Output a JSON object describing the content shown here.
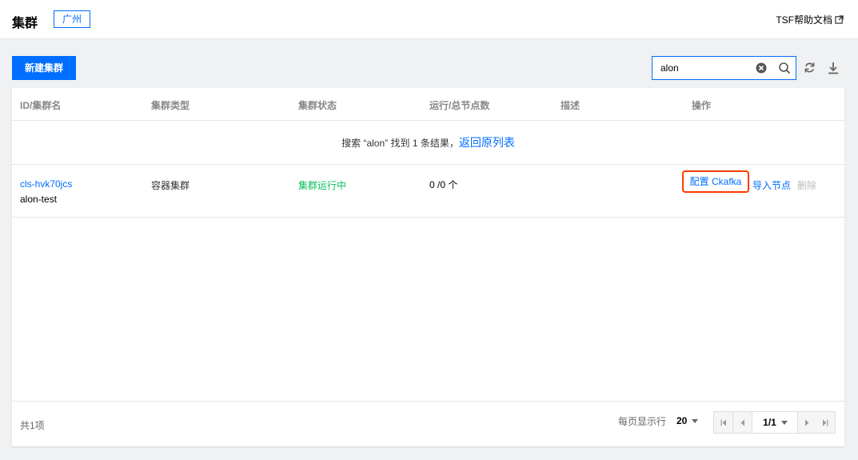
{
  "header": {
    "title": "集群",
    "region": "广州",
    "help_link": "TSF帮助文档"
  },
  "toolbar": {
    "new_button": "新建集群",
    "search_value": "alon"
  },
  "table": {
    "columns": [
      "ID/集群名",
      "集群类型",
      "集群状态",
      "运行/总节点数",
      "描述",
      "操作"
    ],
    "search_result_prefix": "搜索 “alon” 找到 1 条结果，",
    "search_result_link": "返回原列表",
    "rows": [
      {
        "id": "cls-hvk70jcs",
        "name": "alon-test",
        "type": "容器集群",
        "status": "集群运行中",
        "nodes": "0 /0 个",
        "description": "",
        "actions": {
          "config": "配置 Ckafka",
          "import": "导入节点",
          "delete": "删除"
        }
      }
    ]
  },
  "footer": {
    "total": "共1项",
    "per_page_label": "每页显示行",
    "per_page_value": "20",
    "page_indicator": "1/1"
  },
  "colors": {
    "primary": "#006eff",
    "status_running": "#0abf5b",
    "highlight_border": "#ff3b00"
  }
}
